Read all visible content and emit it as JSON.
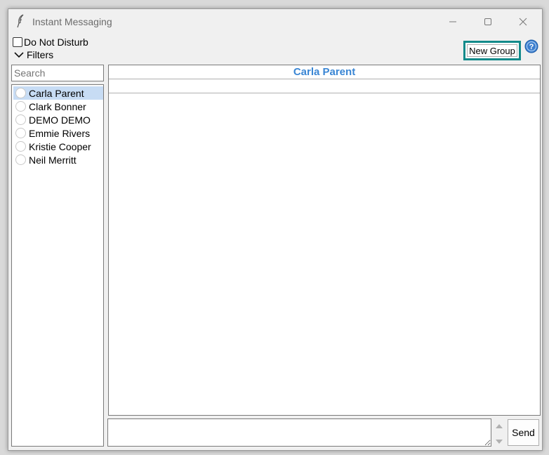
{
  "window": {
    "title": "Instant Messaging"
  },
  "toolbar": {
    "do_not_disturb_label": "Do Not Disturb",
    "do_not_disturb_checked": false,
    "filters_label": "Filters",
    "new_group_label": "New Group",
    "help_icon": "help-icon"
  },
  "search": {
    "placeholder": "Search"
  },
  "contacts": [
    {
      "name": "Carla Parent",
      "selected": true
    },
    {
      "name": "Clark Bonner",
      "selected": false
    },
    {
      "name": "DEMO DEMO",
      "selected": false
    },
    {
      "name": "Emmie Rivers",
      "selected": false
    },
    {
      "name": "Kristie Cooper",
      "selected": false
    },
    {
      "name": "Neil Merritt",
      "selected": false
    }
  ],
  "chat": {
    "recipient": "Carla Parent"
  },
  "composer": {
    "send_label": "Send"
  },
  "colors": {
    "accent_highlight": "#138a8a",
    "chat_title": "#3a86d4",
    "selection": "#c7dcf4"
  }
}
